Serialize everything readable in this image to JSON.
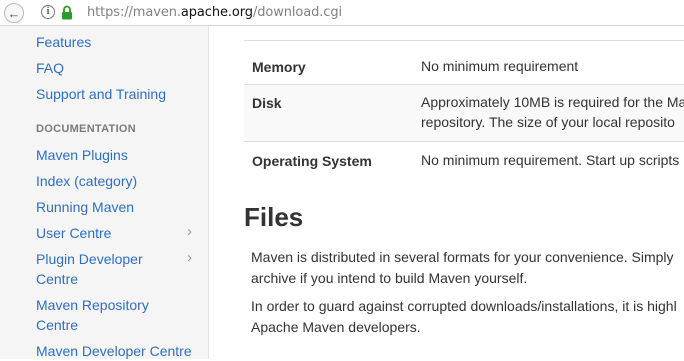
{
  "browser": {
    "url_prefix": "https://maven.",
    "url_domain": "apache.org",
    "url_path": "/download.cgi",
    "info_glyph": "i",
    "back_glyph": "←"
  },
  "sidebar": {
    "items_top": [
      {
        "label": "Features"
      },
      {
        "label": "FAQ"
      },
      {
        "label": "Support and Training"
      }
    ],
    "section_header": "DOCUMENTATION",
    "items_doc": [
      {
        "label": "Maven Plugins"
      },
      {
        "label": "Index (category)"
      },
      {
        "label": "Running Maven"
      },
      {
        "label": "User Centre"
      },
      {
        "label_line1": "Plugin Developer",
        "label_line2": "Centre"
      },
      {
        "label_line1": "Maven Repository",
        "label_line2": "Centre"
      },
      {
        "label": "Maven Developer Centre"
      }
    ],
    "chevron_glyph": "›"
  },
  "requirements": {
    "rows": [
      {
        "name": "Memory",
        "value": "No minimum requirement"
      },
      {
        "name": "Disk",
        "value_line1": "Approximately 10MB is required for the Ma",
        "value_line2": "repository. The size of your local reposito"
      },
      {
        "name": "Operating System",
        "value": "No minimum requirement. Start up scripts"
      }
    ]
  },
  "files": {
    "heading": "Files",
    "para1_line1": "Maven is distributed in several formats for your convenience. Simply",
    "para1_line2": "archive if you intend to build Maven yourself.",
    "para2_line1": "In order to guard against corrupted downloads/installations, it is highl",
    "para2_line2": "Apache Maven developers."
  },
  "colors": {
    "link": "#2e6ec2",
    "lock": "#2a9d2a"
  }
}
